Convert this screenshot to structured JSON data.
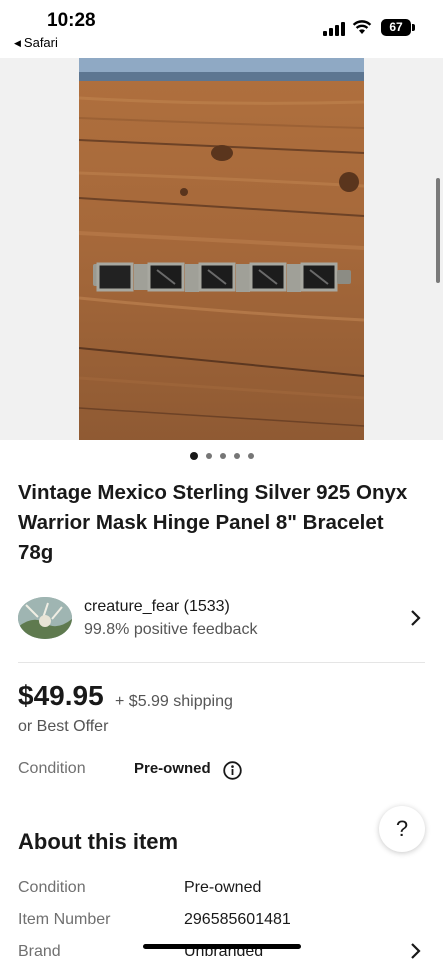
{
  "status_bar": {
    "time": "10:28",
    "back_app": "Safari",
    "battery": "67"
  },
  "gallery": {
    "image_count": 5,
    "active_index": 0
  },
  "listing": {
    "title": "Vintage Mexico Sterling Silver 925 Onyx Warrior Mask Hinge Panel 8\" Bracelet 78g"
  },
  "seller": {
    "name": "creature_fear (1533)",
    "feedback": "99.8% positive feedback"
  },
  "pricing": {
    "price": "$49.95",
    "shipping": "+ $5.99 shipping",
    "offer": "or Best Offer"
  },
  "condition": {
    "label": "Condition",
    "value": "Pre-owned"
  },
  "help": {
    "label": "?"
  },
  "about": {
    "heading": "About this item",
    "specs": [
      {
        "label": "Condition",
        "value": "Pre-owned"
      },
      {
        "label": "Item Number",
        "value": "296585601481"
      },
      {
        "label": "Brand",
        "value": "Unbranded"
      }
    ]
  },
  "colors": {
    "text_primary": "#191919",
    "text_secondary": "#707070",
    "divider": "#e5e5e5"
  }
}
